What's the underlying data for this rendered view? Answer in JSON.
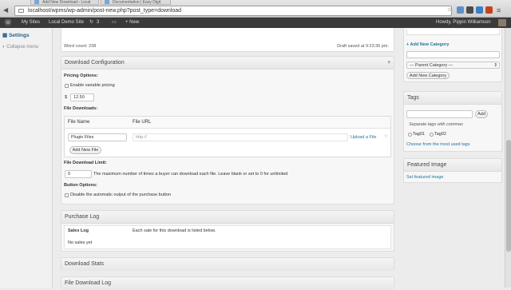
{
  "browser": {
    "tabs": [
      "Add New Download ‹ Local",
      "Documentation | Easy Digit"
    ],
    "url": "localhost/wpms/wp-admin/post-new.php?post_type=download"
  },
  "adminbar": {
    "my_sites": "My Sites",
    "site_name": "Local Demo Site",
    "updates_count": "3",
    "new_label": "+ New",
    "howdy": "Howdy, Pippin Williamson"
  },
  "sidebar": {
    "settings": "Settings",
    "collapse": "Collapse menu"
  },
  "editor": {
    "word_count": "Word count: 238",
    "draft_saved": "Draft saved at 9:23:36 pm."
  },
  "download_config": {
    "title": "Download Configuration",
    "pricing_label": "Pricing Options:",
    "variable_pricing": "Enable variable pricing",
    "currency": "$",
    "price": "12.50",
    "file_downloads_label": "File Downloads:",
    "col_file_name": "File Name",
    "col_file_url": "File URL",
    "file_name_value": "Plugin Files",
    "file_url_placeholder": "http://",
    "upload_link": "Upload a File",
    "add_new_file": "Add New File",
    "limit_label": "File Download Limit:",
    "limit_value": "0",
    "limit_help": "The maximum number of times a buyer can download each file. Leave blank or set to 0 for unlimited",
    "button_options_label": "Button Options:",
    "disable_button": "Disable the automatic output of the purchase button"
  },
  "purchase_log": {
    "title": "Purchase Log",
    "sales_log": "Sales Log",
    "sales_help": "Each sale for this download is listed below.",
    "no_sales": "No sales yet"
  },
  "download_stats": {
    "title": "Download Stats"
  },
  "file_download_log": {
    "title": "File Download Log"
  },
  "categories": {
    "add_new": "+ Add New Category",
    "parent_select": "— Parent Category —",
    "add_button": "Add New Category"
  },
  "tags": {
    "title": "Tags",
    "add_button": "Add",
    "separate_help": "Separate tags with commas",
    "tag1": "Tag01",
    "tag2": "Tag02",
    "choose_link": "Choose from the most used tags"
  },
  "featured_image": {
    "title": "Featured Image",
    "set_link": "Set featured image"
  }
}
